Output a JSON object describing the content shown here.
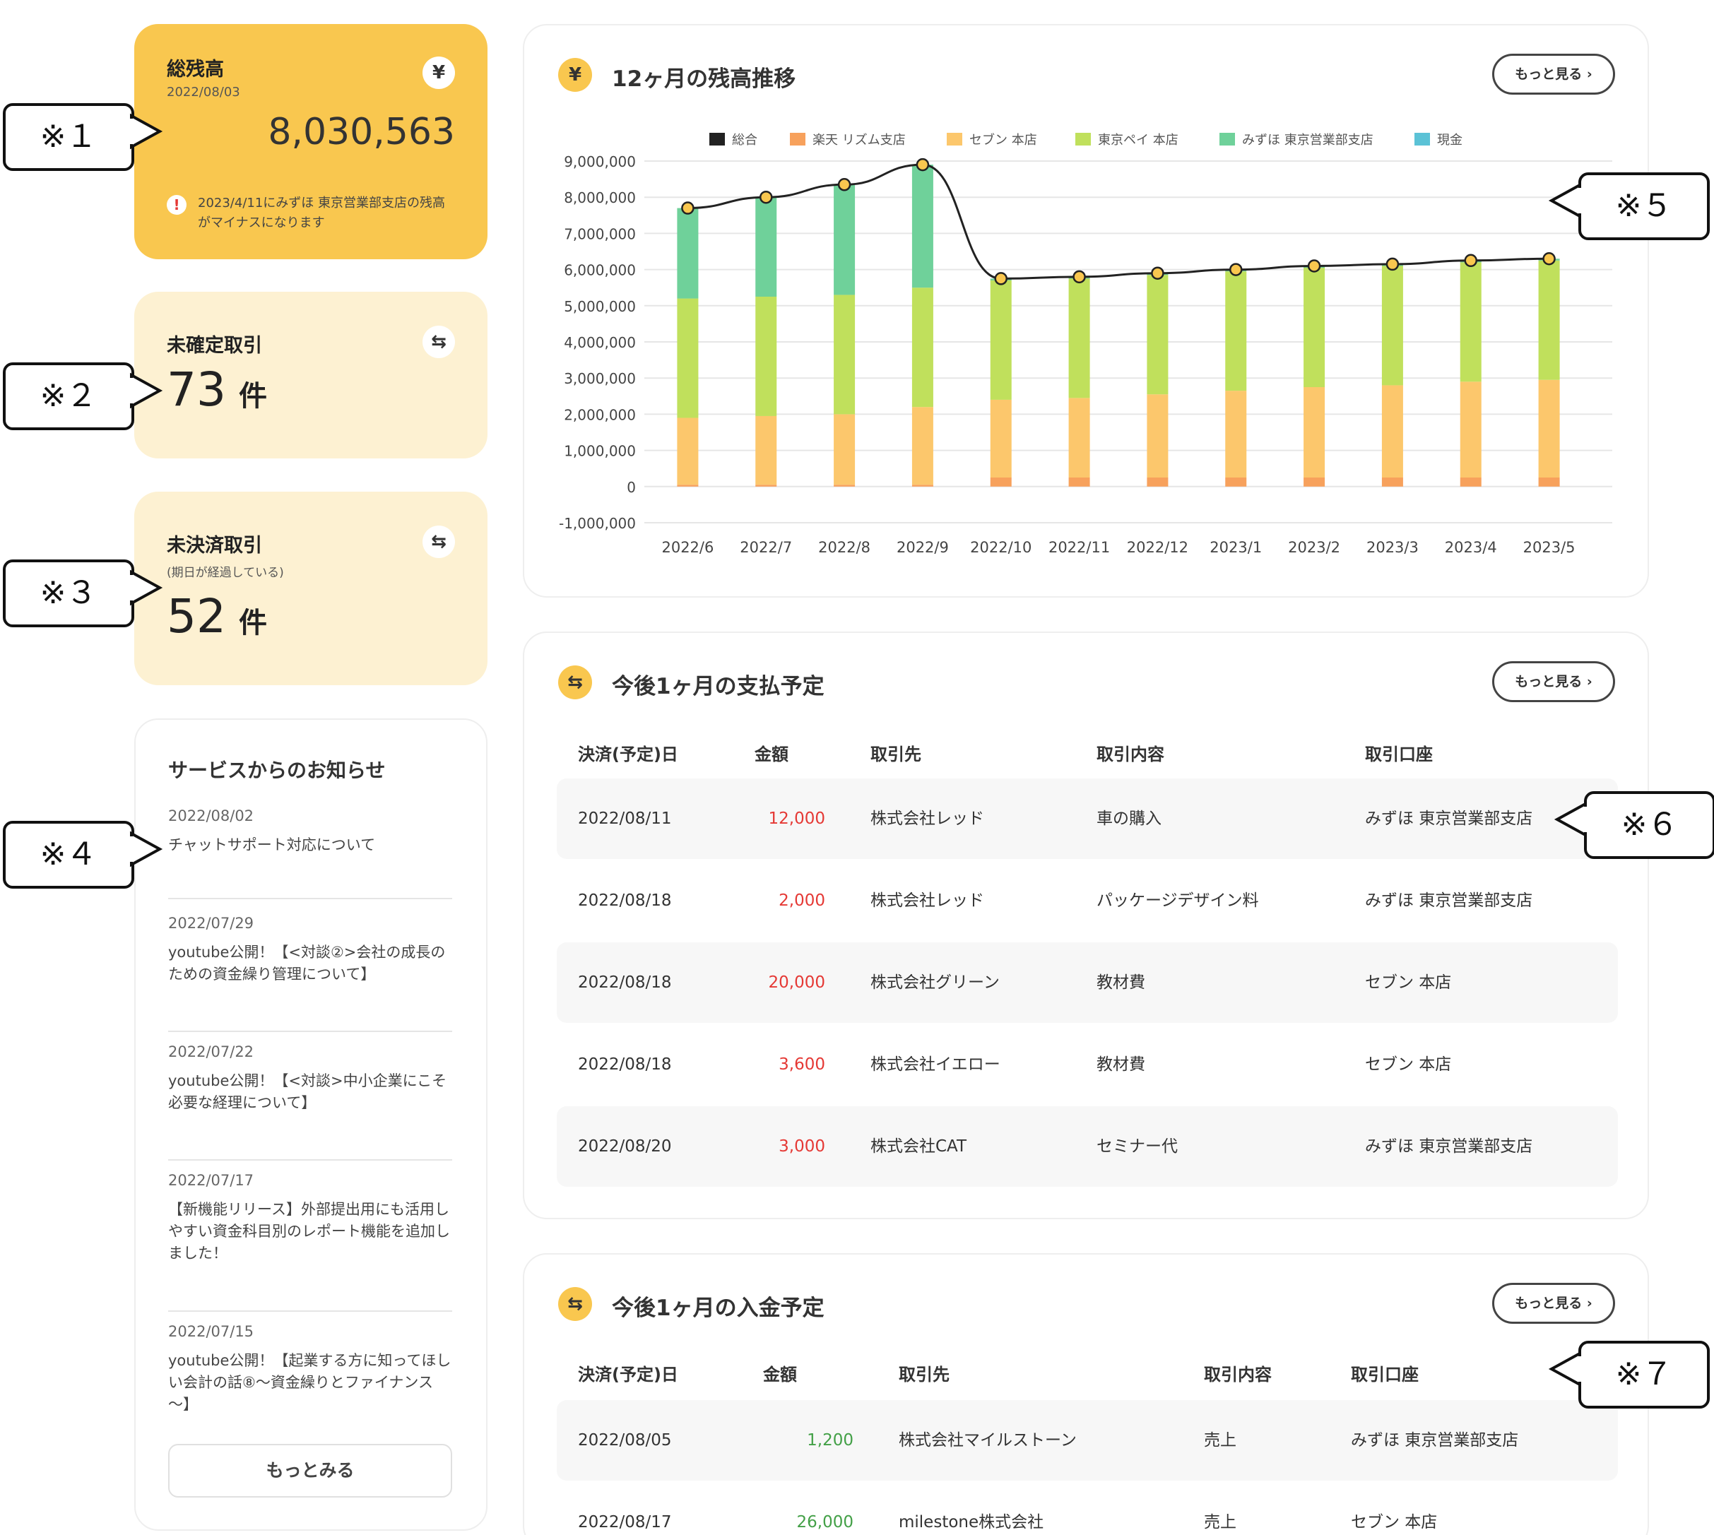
{
  "total_balance": {
    "title": "総残高",
    "date": "2022/08/03",
    "amount": "8,030,563",
    "icon": "yen-icon",
    "warning": "2023/4/11にみずほ 東京営業部支店の残高がマイナスになります"
  },
  "unconfirmed": {
    "title": "未確定取引",
    "count": "73",
    "unit": "件",
    "icon": "exchange-icon"
  },
  "unsettled": {
    "title": "未決済取引",
    "subtitle": "(期日が経過している)",
    "count": "52",
    "unit": "件",
    "icon": "exchange-icon"
  },
  "news": {
    "title": "サービスからのお知らせ",
    "items": [
      {
        "date": "2022/08/02",
        "text": "チャットサポート対応について"
      },
      {
        "date": "2022/07/29",
        "text": "youtube公開！【<対談②>会社の成長のための資金繰り管理について】"
      },
      {
        "date": "2022/07/22",
        "text": "youtube公開！【<対談>中小企業にこそ必要な経理について】"
      },
      {
        "date": "2022/07/17",
        "text": "【新機能リリース】外部提出用にも活用しやすい資金科目別のレポート機能を追加しました！"
      },
      {
        "date": "2022/07/15",
        "text": "youtube公開！【起業する方に知ってほしい会計の話⑧～資金繰りとファイナンス～】"
      }
    ],
    "more_label": "もっとみる"
  },
  "balance_chart": {
    "title": "12ヶ月の残高推移",
    "more_label": "もっと見る ›"
  },
  "chart_data": {
    "type": "bar",
    "stacked": true,
    "categories": [
      "2022/6",
      "2022/7",
      "2022/8",
      "2022/9",
      "2022/10",
      "2022/11",
      "2022/12",
      "2023/1",
      "2023/2",
      "2023/3",
      "2023/4",
      "2023/5"
    ],
    "ylim": [
      -1000000,
      9000000
    ],
    "yticks": [
      "9,000,000",
      "8,000,000",
      "7,000,000",
      "6,000,000",
      "5,000,000",
      "4,000,000",
      "3,000,000",
      "2,000,000",
      "1,000,000",
      "0",
      "-1,000,000"
    ],
    "ytick_values": [
      9000000,
      8000000,
      7000000,
      6000000,
      5000000,
      4000000,
      3000000,
      2000000,
      1000000,
      0,
      -1000000
    ],
    "grid": true,
    "legend": "top",
    "series": [
      {
        "name": "楽天 リズム支店",
        "color": "#f7a15c",
        "values": [
          50000,
          50000,
          50000,
          50000,
          250000,
          250000,
          250000,
          250000,
          250000,
          250000,
          250000,
          250000
        ]
      },
      {
        "name": "セブン 本店",
        "color": "#fcc76c",
        "values": [
          1850000,
          1900000,
          1950000,
          2150000,
          2150000,
          2200000,
          2300000,
          2400000,
          2500000,
          2550000,
          2650000,
          2700000
        ]
      },
      {
        "name": "東京ペイ 本店",
        "color": "#c0e05c",
        "values": [
          3300000,
          3300000,
          3300000,
          3300000,
          3300000,
          3300000,
          3300000,
          3300000,
          3300000,
          3300000,
          3300000,
          3300000
        ]
      },
      {
        "name": "みずほ 東京営業部支店",
        "color": "#6fd19a",
        "values": [
          2500000,
          2750000,
          3050000,
          3400000,
          50000,
          50000,
          50000,
          50000,
          50000,
          50000,
          50000,
          50000
        ]
      },
      {
        "name": "現金",
        "color": "#5bc2d6",
        "values": [
          0,
          0,
          0,
          0,
          0,
          0,
          0,
          0,
          0,
          0,
          0,
          0
        ]
      }
    ],
    "line": {
      "name": "総合",
      "color": "#222222",
      "values": [
        7700000,
        8000000,
        8350000,
        8900000,
        5750000,
        5800000,
        5900000,
        6000000,
        6100000,
        6150000,
        6250000,
        6300000
      ]
    }
  },
  "payments": {
    "title": "今後1ヶ月の支払予定",
    "more_label": "もっと見る ›",
    "headers": [
      "決済(予定)日",
      "金額",
      "取引先",
      "取引内容",
      "取引口座"
    ],
    "rows": [
      {
        "date": "2022/08/11",
        "amount": "12,000",
        "partner": "株式会社レッド",
        "content": "車の購入",
        "account": "みずほ 東京営業部支店"
      },
      {
        "date": "2022/08/18",
        "amount": "2,000",
        "partner": "株式会社レッド",
        "content": "パッケージデザイン料",
        "account": "みずほ 東京営業部支店"
      },
      {
        "date": "2022/08/18",
        "amount": "20,000",
        "partner": "株式会社グリーン",
        "content": "教材費",
        "account": "セブン 本店"
      },
      {
        "date": "2022/08/18",
        "amount": "3,600",
        "partner": "株式会社イエロー",
        "content": "教材費",
        "account": "セブン 本店"
      },
      {
        "date": "2022/08/20",
        "amount": "3,000",
        "partner": "株式会社CAT",
        "content": "セミナー代",
        "account": "みずほ 東京営業部支店"
      }
    ]
  },
  "incomes": {
    "title": "今後1ヶ月の入金予定",
    "more_label": "もっと見る ›",
    "headers": [
      "決済(予定)日",
      "金額",
      "取引先",
      "取引内容",
      "取引口座"
    ],
    "rows": [
      {
        "date": "2022/08/05",
        "amount": "1,200",
        "partner": "株式会社マイルストーン",
        "content": "売上",
        "account": "みずほ 東京営業部支店"
      },
      {
        "date": "2022/08/17",
        "amount": "26,000",
        "partner": "milestone株式会社",
        "content": "売上",
        "account": "セブン 本店"
      }
    ]
  },
  "callouts": [
    "※１",
    "※２",
    "※３",
    "※４",
    "※５",
    "※６",
    "※７"
  ]
}
